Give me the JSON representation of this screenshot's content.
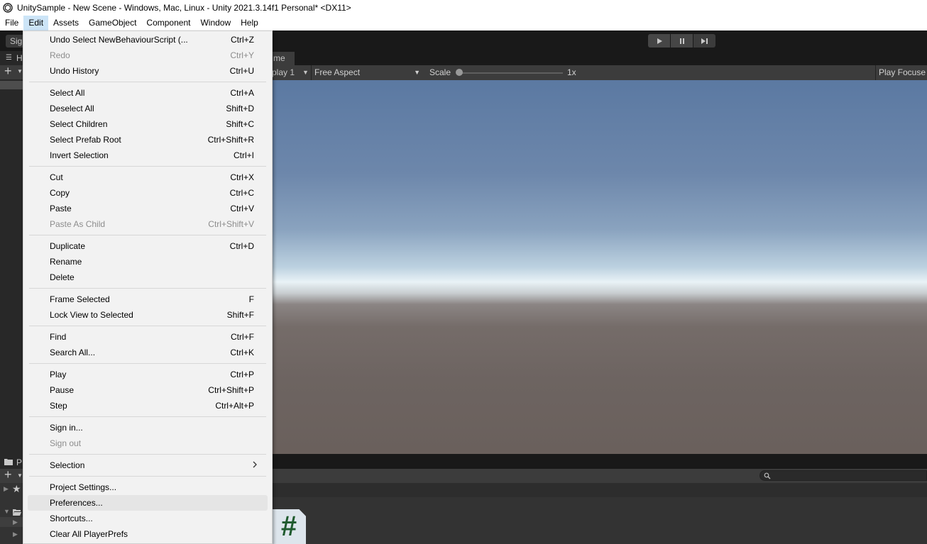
{
  "window": {
    "title": "UnitySample - New Scene - Windows, Mac, Linux - Unity 2021.3.14f1 Personal* <DX11>"
  },
  "menubar": {
    "items": [
      "File",
      "Edit",
      "Assets",
      "GameObject",
      "Component",
      "Window",
      "Help"
    ],
    "active": "Edit"
  },
  "toolbar": {
    "signin_label": "Sig"
  },
  "hierarchy": {
    "tab_label": "H"
  },
  "game": {
    "tab_label": "me",
    "display_label": "play 1",
    "aspect_label": "Free Aspect",
    "scale_label": "Scale",
    "scale_value_label": "1x",
    "scale_value": 1,
    "play_focused_label": "Play Focuse"
  },
  "project": {
    "tab_label": "P"
  },
  "edit_menu": {
    "items": [
      {
        "label": "Undo Select NewBehaviourScript (...",
        "shortcut": "Ctrl+Z",
        "disabled": false
      },
      {
        "label": "Redo",
        "shortcut": "Ctrl+Y",
        "disabled": true
      },
      {
        "label": "Undo History",
        "shortcut": "Ctrl+U",
        "disabled": false
      },
      {
        "label": "Select All",
        "shortcut": "Ctrl+A",
        "disabled": false
      },
      {
        "label": "Deselect All",
        "shortcut": "Shift+D",
        "disabled": false
      },
      {
        "label": "Select Children",
        "shortcut": "Shift+C",
        "disabled": false
      },
      {
        "label": "Select Prefab Root",
        "shortcut": "Ctrl+Shift+R",
        "disabled": false
      },
      {
        "label": "Invert Selection",
        "shortcut": "Ctrl+I",
        "disabled": false
      },
      {
        "label": "Cut",
        "shortcut": "Ctrl+X",
        "disabled": false
      },
      {
        "label": "Copy",
        "shortcut": "Ctrl+C",
        "disabled": false
      },
      {
        "label": "Paste",
        "shortcut": "Ctrl+V",
        "disabled": false
      },
      {
        "label": "Paste As Child",
        "shortcut": "Ctrl+Shift+V",
        "disabled": true
      },
      {
        "label": "Duplicate",
        "shortcut": "Ctrl+D",
        "disabled": false
      },
      {
        "label": "Rename",
        "shortcut": "",
        "disabled": false
      },
      {
        "label": "Delete",
        "shortcut": "",
        "disabled": false
      },
      {
        "label": "Frame Selected",
        "shortcut": "F",
        "disabled": false
      },
      {
        "label": "Lock View to Selected",
        "shortcut": "Shift+F",
        "disabled": false
      },
      {
        "label": "Find",
        "shortcut": "Ctrl+F",
        "disabled": false
      },
      {
        "label": "Search All...",
        "shortcut": "Ctrl+K",
        "disabled": false
      },
      {
        "label": "Play",
        "shortcut": "Ctrl+P",
        "disabled": false
      },
      {
        "label": "Pause",
        "shortcut": "Ctrl+Shift+P",
        "disabled": false
      },
      {
        "label": "Step",
        "shortcut": "Ctrl+Alt+P",
        "disabled": false
      },
      {
        "label": "Sign in...",
        "shortcut": "",
        "disabled": false
      },
      {
        "label": "Sign out",
        "shortcut": "",
        "disabled": true
      },
      {
        "label": "Selection",
        "shortcut": "",
        "disabled": false,
        "submenu": true
      },
      {
        "label": "Project Settings...",
        "shortcut": "",
        "disabled": false
      },
      {
        "label": "Preferences...",
        "shortcut": "",
        "disabled": false,
        "hovered": true
      },
      {
        "label": "Shortcuts...",
        "shortcut": "",
        "disabled": false
      },
      {
        "label": "Clear All PlayerPrefs",
        "shortcut": "",
        "disabled": false
      }
    ]
  },
  "asset": {
    "glyph": "#"
  },
  "icons": {
    "app": "unity-logo-icon",
    "play": "play-icon",
    "pause": "pause-icon",
    "step": "step-icon",
    "search": "search-icon",
    "add": "plus-icon",
    "submenu": "chevron-right-icon"
  }
}
